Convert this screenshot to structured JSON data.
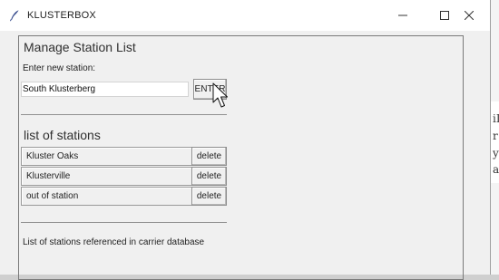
{
  "window": {
    "title": "KLUSTERBOX",
    "icon": "feather-icon",
    "controls": [
      "minimize-icon",
      "maximize-icon",
      "close-icon"
    ]
  },
  "manage": {
    "heading": "Manage Station List",
    "prompt": "Enter new station:",
    "input_value": "South Klusterberg",
    "enter_label": "ENTER"
  },
  "stations": {
    "heading": "list of stations",
    "delete_label": "delete",
    "items": [
      "Kluster Oaks",
      "Klusterville",
      "out of station"
    ]
  },
  "footer_label": "List of stations referenced in carrier database",
  "background_glyphs": [
    "iL",
    "r",
    "y",
    "ar"
  ]
}
